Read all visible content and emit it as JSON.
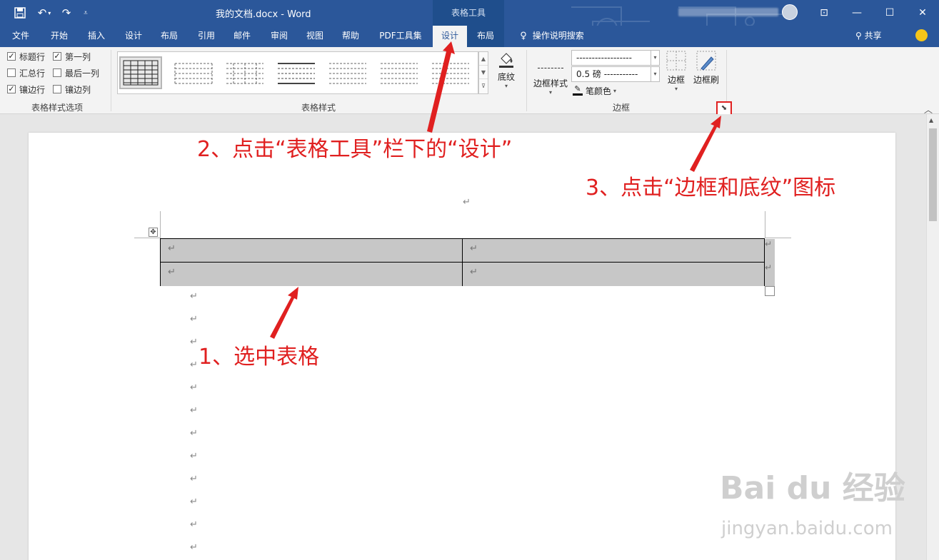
{
  "titlebar": {
    "doc_title": "我的文档.docx  -  Word",
    "context_title": "表格工具",
    "share_label": "共享"
  },
  "tabs": [
    {
      "label": "文件"
    },
    {
      "label": "开始"
    },
    {
      "label": "插入"
    },
    {
      "label": "设计"
    },
    {
      "label": "布局"
    },
    {
      "label": "引用"
    },
    {
      "label": "邮件"
    },
    {
      "label": "审阅"
    },
    {
      "label": "视图"
    },
    {
      "label": "帮助"
    },
    {
      "label": "PDF工具集"
    },
    {
      "label": "设计",
      "active": true
    },
    {
      "label": "布局"
    },
    {
      "label": "操作说明搜索"
    }
  ],
  "ribbon": {
    "style_options": {
      "group_label": "表格样式选项",
      "items": [
        {
          "label": "标题行",
          "checked": true
        },
        {
          "label": "第一列",
          "checked": true
        },
        {
          "label": "汇总行",
          "checked": false
        },
        {
          "label": "最后一列",
          "checked": false
        },
        {
          "label": "镶边行",
          "checked": true
        },
        {
          "label": "镶边列",
          "checked": false
        }
      ]
    },
    "table_styles": {
      "group_label": "表格样式",
      "shading_label": "底纹"
    },
    "borders": {
      "group_label": "边框",
      "border_styles_label": "边框样式",
      "line_style_value": "------------------",
      "line_weight_value": "0.5 磅  -----------",
      "pen_color_label": "笔颜色",
      "borders_label": "边框",
      "border_painter_label": "边框刷"
    }
  },
  "document": {
    "paragraph_mark": "↵",
    "table": {
      "rows": [
        [
          "↵",
          "↵"
        ],
        [
          "↵",
          "↵"
        ]
      ]
    }
  },
  "annotations": {
    "step1": "1、选中表格",
    "step2": "2、点击“表格工具”栏下的“设计”",
    "step3": "3、点击“边框和底纹”图标",
    "color": "#e02020"
  },
  "watermark": {
    "logo": "Bai du 经验",
    "url": "jingyan.baidu.com"
  },
  "colors": {
    "brand": "#2b579a",
    "context": "#1f4e8c",
    "ribbon_bg": "#f3f3f3",
    "selection": "#c7c7c7"
  }
}
